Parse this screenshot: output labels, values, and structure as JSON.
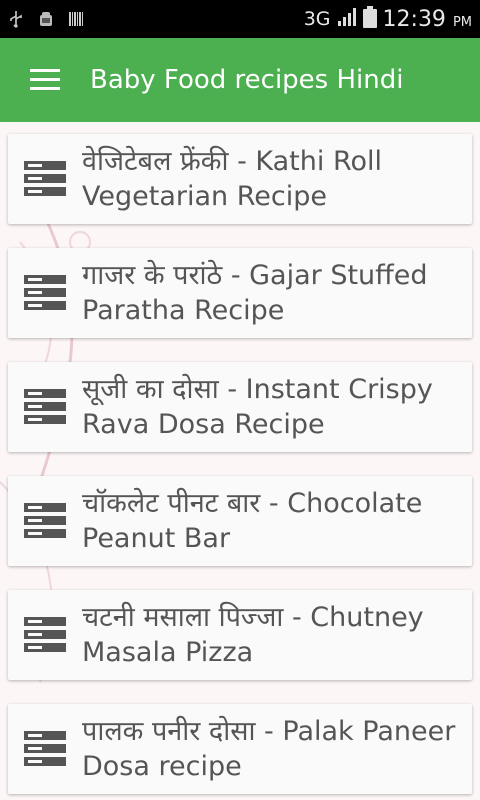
{
  "status_bar": {
    "network": "3G",
    "time": "12:39",
    "ampm": "PM",
    "icons": [
      "usb-icon",
      "android-debug-icon",
      "barcode-icon",
      "signal-icon",
      "battery-icon"
    ]
  },
  "app_bar": {
    "title": "Baby Food recipes Hindi",
    "color": "#4caf50",
    "menu_icon": "hamburger-menu-icon"
  },
  "recipes": [
    {
      "line1": "वेजिटेबल फ्रेंकी - Kathi Roll",
      "line2": "Vegetarian Recipe"
    },
    {
      "line1": "गाजर के परांठे - Gajar Stuffed",
      "line2": "Paratha Recipe"
    },
    {
      "line1": "सूजी का दोसा - Instant Crispy",
      "line2": "Rava Dosa Recipe"
    },
    {
      "line1": "चॉकलेट पीनट बार - Chocolate",
      "line2": "Peanut Bar"
    },
    {
      "line1": "चटनी मसाला पिज्जा - Chutney",
      "line2": "Masala Pizza"
    },
    {
      "line1": "पालक पनीर दोसा - Palak Paneer",
      "line2": "Dosa recipe"
    }
  ],
  "list_item_icon": "list-item-icon"
}
